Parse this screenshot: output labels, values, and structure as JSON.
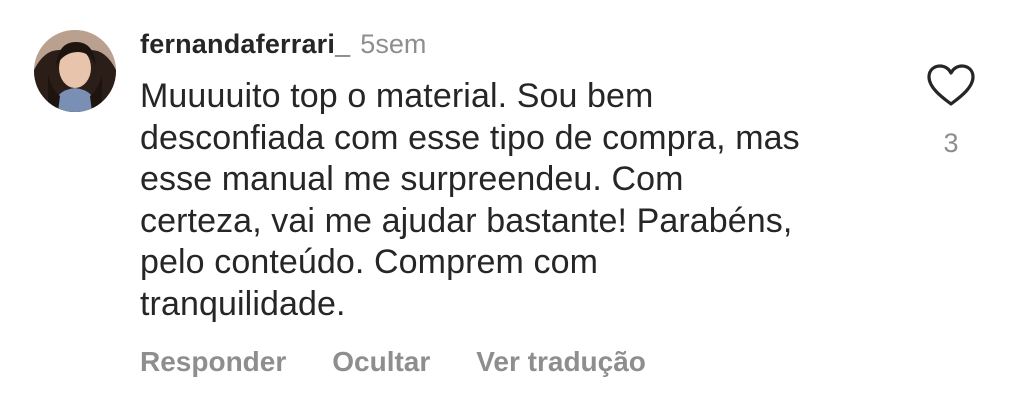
{
  "comment": {
    "username": "fernandaferrari_",
    "time": "5sem",
    "lines": [
      "Muuuuito top o material. Sou bem",
      "desconfiada com esse tipo de compra, mas",
      "esse manual me surpreendeu. Com",
      "certeza, vai me ajudar bastante! Parabéns,",
      "pelo conteúdo. Comprem com",
      "tranquilidade."
    ],
    "like_count": "3"
  },
  "actions": {
    "reply": "Responder",
    "hide": "Ocultar",
    "translate": "Ver tradução"
  },
  "icons": {
    "like": "heart-outline-icon",
    "avatar": "user-avatar"
  },
  "colors": {
    "text": "#262626",
    "secondary": "#8e8e8e",
    "background": "#ffffff"
  }
}
